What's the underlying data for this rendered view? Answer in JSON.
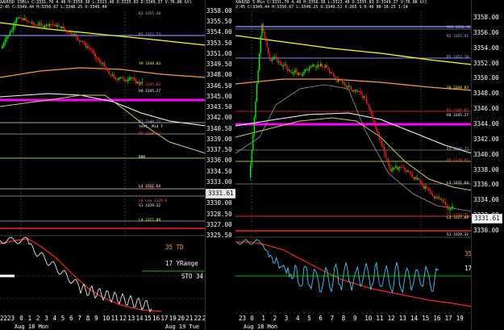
{
  "left_chart": {
    "header_line1": "XAUUSD 15Min  C:3331.70  4.48 H:3358.38 L:3323.48 O:3335.83 D:3349.37 V:76.8K Gtl",
    "header_line2": "2:45  C:3349.44 H:3350.67 L:3348.25 O:3349.44",
    "levels": [
      {
        "label": "R2  3355.48",
        "color": "#b3b3ff"
      },
      {
        "label": "R5  3352.73",
        "color": "#b3b3ff"
      },
      {
        "label": "YH  3348.83",
        "color": "#ffff66"
      },
      {
        "label": "R1  3345.82",
        "color": "#ff5555"
      },
      {
        "label": "H4  3345.27",
        "color": "#ffffff"
      },
      {
        "label": "R3  3340.72",
        "color": "#b3b3ff"
      },
      {
        "label": "Yest. Mid f",
        "color": "#ffffff"
      },
      {
        "label": "PP  3338.97",
        "color": "#ff5555"
      },
      {
        "label": "RRR",
        "color": "#ffffff"
      },
      {
        "label": "L3  3331.64",
        "color": "#ffffff"
      },
      {
        "label": "S1  3330.71",
        "color": "#ff5555"
      },
      {
        "label": "LH Low  3329.0",
        "color": "#ff5555"
      },
      {
        "label": "S1  3329.32",
        "color": "#ffffff"
      },
      {
        "label": "L4  3327.09",
        "color": "#ffff66"
      }
    ],
    "ind_labels": {
      "td": "35 TD",
      "range": "17 YRange",
      "sto": "STO"
    },
    "x_labels": [
      "2223",
      "0",
      "1",
      "2",
      "3",
      "4",
      "5",
      "6",
      "7",
      "8",
      "9",
      "10",
      "11",
      "12",
      "13",
      "14",
      "15",
      "16",
      "17",
      "19",
      "20",
      "21",
      "22",
      "23"
    ],
    "date_labels": [
      "Aug 18 Mon",
      "Aug 19 Tue"
    ],
    "right_sto_value": "34"
  },
  "center_scale": {
    "prices": [
      "3358.00",
      "3355.50",
      "3354.00",
      "3353.50",
      "3351.00",
      "3349.50",
      "3348.00",
      "3346.50",
      "3345.00",
      "3343.50",
      "3342.00",
      "3340.50",
      "3339.00",
      "3337.50",
      "3336.00",
      "3334.50",
      "3333.00",
      "3331.61",
      "3330.00",
      "3328.50",
      "3327.00",
      "3325.50"
    ],
    "current": "3331.61"
  },
  "right_chart": {
    "header_line1": "XAUUSD 5-Min  C:3331.70  4.48 H:3358.38 L:3323.48 O:3335.83 D:3349.37 V:76.8K Gtl",
    "header_line2": "2:45  C:3349.44 H:3350.67 L:3349.25 O:3349.51 V:265 S:0.46 08-18-25 1:14",
    "levels": [
      {
        "label": "MHO  3356.92",
        "color": "#b3b3ff"
      },
      {
        "label": "R2  3355.41",
        "color": "#b3b3ff"
      },
      {
        "label": "R5  3352.70",
        "color": "#b3b3ff"
      },
      {
        "label": "YH  3348.83",
        "color": "#ffff66"
      },
      {
        "label": "R1  3345.82",
        "color": "#ff5555"
      },
      {
        "label": "H4  3345.27",
        "color": "#ffffff"
      },
      {
        "label": "R3  3340.72",
        "color": "#b3b3ff"
      },
      {
        "label": "PP  3338.97",
        "color": "#ff5555"
      },
      {
        "label": "L3  3331.64",
        "color": "#ffffff"
      },
      {
        "label": "S1  3330.71",
        "color": "#ff5555"
      },
      {
        "label": "L4  3327.09",
        "color": "#ffff66"
      },
      {
        "label": "S1  3329.32",
        "color": "#ffffff"
      }
    ],
    "ind_labels": {
      "td": "35 TD",
      "range": "17 YRange",
      "sto": "STO"
    },
    "sto_values": [
      "75.00",
      "50.00",
      "25.00"
    ],
    "x_labels": [
      "23",
      "0",
      "1",
      "2",
      "3",
      "4",
      "5",
      "6",
      "7",
      "8",
      "9",
      "10",
      "11",
      "12",
      "13",
      "14",
      "15",
      "16",
      "17",
      "19"
    ],
    "date_label": "Aug 18 Mon",
    "sto_value": "64",
    "macd_label": "MACD 12"
  },
  "right_scale": {
    "prices": [
      "3358.00",
      "3356.00",
      "3354.00",
      "3352.00",
      "3350.00",
      "3348.00",
      "3346.00",
      "3344.00",
      "3342.00",
      "3340.00",
      "3338.00",
      "3336.00",
      "3334.00",
      "3332.00",
      "3330.00"
    ],
    "current": "3331.61"
  },
  "colors": {
    "magenta": "#ff00ff",
    "red": "#ff2222",
    "yellow": "#ffff00",
    "orange": "#ff9933",
    "green": "#00ff00",
    "cyan": "#33ccff",
    "white": "#ffffff"
  }
}
